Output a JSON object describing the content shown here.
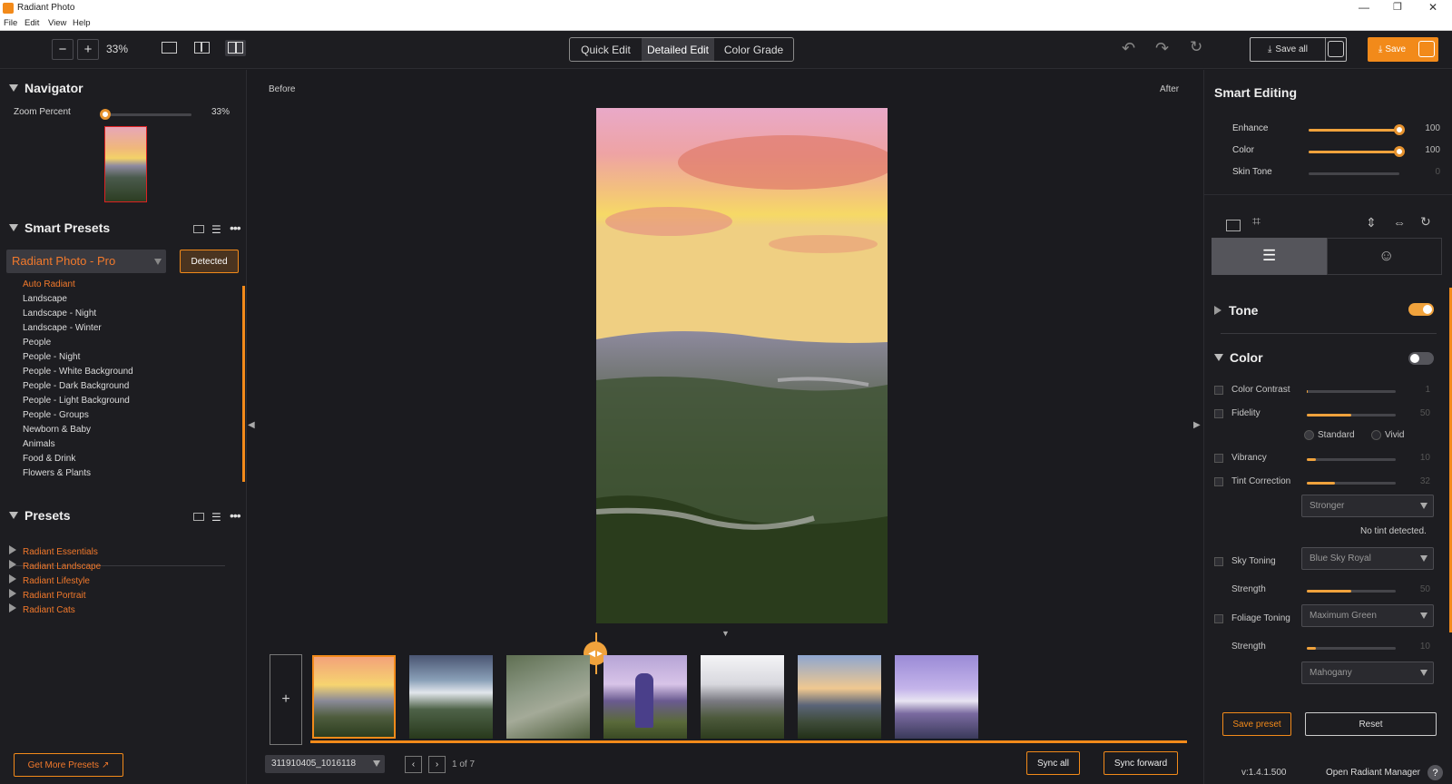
{
  "window": {
    "title": "Radiant Photo"
  },
  "menu": [
    "File",
    "Edit",
    "View",
    "Help"
  ],
  "toolbar": {
    "zoom_level": "33%",
    "modes": [
      "Quick Edit",
      "Detailed Edit",
      "Color Grade"
    ],
    "active_mode": "Detailed Edit",
    "save_all_label": "Save all",
    "save_label": "Save"
  },
  "navigator": {
    "title": "Navigator",
    "zoom_label": "Zoom Percent",
    "zoom_value": "33%",
    "zoom_fraction": 0.33
  },
  "smart_presets": {
    "title": "Smart Presets",
    "selected_pack": "Radiant Photo - Pro",
    "detected_label": "Detected",
    "items": [
      "Auto Radiant",
      "Landscape",
      "Landscape - Night",
      "Landscape - Winter",
      "People",
      "People - Night",
      "People - White Background",
      "People - Dark Background",
      "People - Light Background",
      "People - Groups",
      "Newborn & Baby",
      "Animals",
      "Food & Drink",
      "Flowers & Plants"
    ],
    "active_item": "Auto Radiant"
  },
  "presets": {
    "title": "Presets",
    "groups": [
      "Radiant Essentials",
      "Radiant Landscape",
      "Radiant Lifestyle",
      "Radiant Portrait",
      "Radiant Cats"
    ]
  },
  "get_more_label": "Get More Presets",
  "canvas": {
    "before_label": "Before",
    "after_label": "After"
  },
  "filmstrip": {
    "filename": "311910405_1016118",
    "page_info": "1 of 7",
    "sync_all_label": "Sync all",
    "sync_forward_label": "Sync forward",
    "add_label": "+"
  },
  "smart_editing": {
    "title": "Smart Editing",
    "sliders": [
      {
        "label": "Enhance",
        "value": "100",
        "fraction": 1.0
      },
      {
        "label": "Color",
        "value": "100",
        "fraction": 1.0
      },
      {
        "label": "Skin Tone",
        "value": "0",
        "fraction": 0.0
      }
    ]
  },
  "tone": {
    "title": "Tone",
    "enabled": true
  },
  "color": {
    "title": "Color",
    "enabled": false,
    "color_contrast": {
      "label": "Color Contrast",
      "value": "1",
      "fraction": 0.01
    },
    "fidelity": {
      "label": "Fidelity",
      "value": "50",
      "fraction": 0.5
    },
    "fidelity_modes": [
      "Standard",
      "Vivid"
    ],
    "vibrancy": {
      "label": "Vibrancy",
      "value": "10",
      "fraction": 0.1
    },
    "tint_correction": {
      "label": "Tint Correction",
      "value": "32",
      "fraction": 0.32
    },
    "tint_mode": "Stronger",
    "tint_note": "No tint detected.",
    "sky_toning": {
      "label": "Sky Toning",
      "preset": "Blue Sky Royal"
    },
    "sky_strength": {
      "label": "Strength",
      "value": "50",
      "fraction": 0.5
    },
    "foliage_toning": {
      "label": "Foliage Toning",
      "preset": "Maximum Green"
    },
    "foliage_strength": {
      "label": "Strength",
      "value": "10",
      "fraction": 0.1
    },
    "foliage_extra": "Mahogany"
  },
  "footer": {
    "save_preset_label": "Save preset",
    "reset_label": "Reset",
    "version": "v:1.4.1.500",
    "manager_label": "Open Radiant Manager",
    "help_label": "?"
  },
  "colors": {
    "accent": "#f28a1a",
    "panel": "#1d1d21",
    "canvas": "#1b1b1f"
  }
}
